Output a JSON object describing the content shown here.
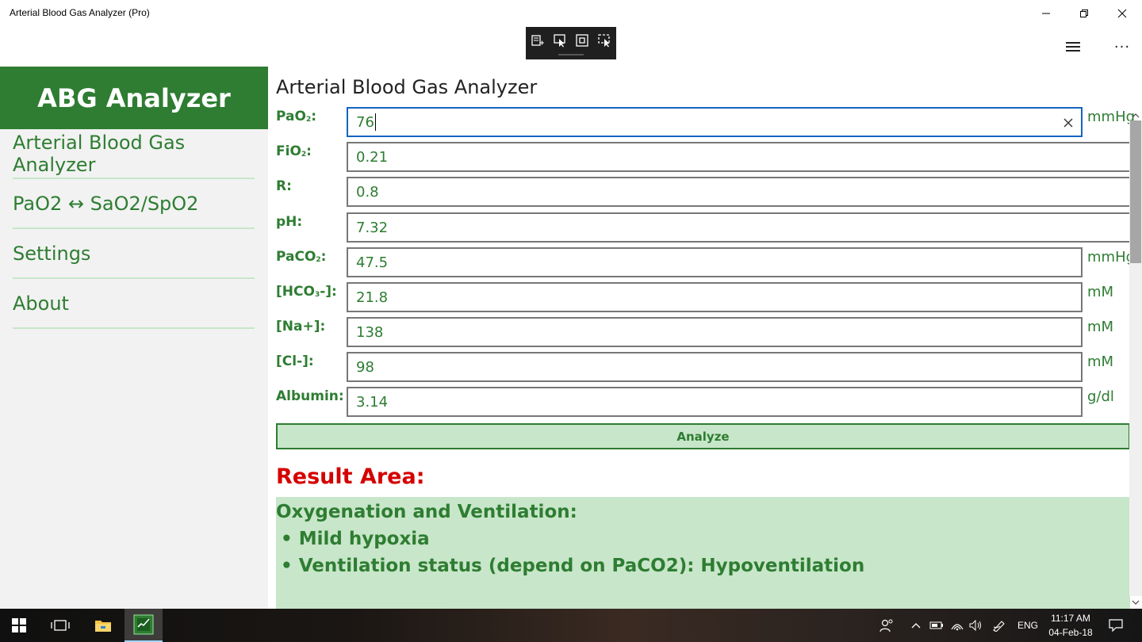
{
  "window": {
    "title": "Arterial Blood Gas Analyzer (Pro)"
  },
  "capture_toolbar": {
    "icons": [
      "snip-edit-icon",
      "select-cursor-icon",
      "window-capture-icon",
      "region-capture-icon"
    ]
  },
  "header": {
    "menu_icon": "hamburger-icon",
    "more_label": "···"
  },
  "sidebar": {
    "brand": "ABG Analyzer",
    "items": [
      {
        "label": "Arterial Blood Gas Analyzer"
      },
      {
        "label": "PaO2 ↔ SaO2/SpO2"
      },
      {
        "label": "Settings"
      },
      {
        "label": "About"
      }
    ]
  },
  "main": {
    "title": "Arterial Blood Gas Analyzer",
    "fields": {
      "pao2": {
        "label_main": "PaO",
        "label_sub": "2",
        "label_end": ":",
        "value": "76",
        "unit": "mmHg"
      },
      "fio2": {
        "label_main": "FiO",
        "label_sub": "2",
        "label_end": ":",
        "value": "0.21"
      },
      "r": {
        "label": "R:",
        "value": "0.8"
      },
      "ph": {
        "label": "pH:",
        "value": "7.32"
      },
      "paco2": {
        "label_main": "PaCO",
        "label_sub": "2",
        "label_end": ":",
        "value": "47.5",
        "unit": "mmHg"
      },
      "hco3": {
        "label_main": "[HCO",
        "label_sub": "3",
        "label_end": "-]:",
        "value": "21.8",
        "unit": "mM"
      },
      "na": {
        "label": "[Na+]:",
        "value": "138",
        "unit": "mM"
      },
      "cl": {
        "label": "[Cl-]:",
        "value": "98",
        "unit": "mM"
      },
      "albumin": {
        "label": "Albumin:",
        "value": "3.14",
        "unit": "g/dl"
      }
    },
    "analyze_label": "Analyze",
    "result": {
      "title": "Result Area:",
      "heading": "Oxygenation and Ventilation:",
      "bullets": [
        "• Mild hypoxia",
        "• Ventilation status (depend on PaCO2): Hypoventilation"
      ]
    }
  },
  "taskbar": {
    "language": "ENG",
    "time": "11:17 AM",
    "date": "04-Feb-18"
  },
  "colors": {
    "accent_green": "#2e7d32",
    "light_green": "#c8e6c9",
    "result_red": "#d50000",
    "focus_blue": "#1565c0"
  }
}
